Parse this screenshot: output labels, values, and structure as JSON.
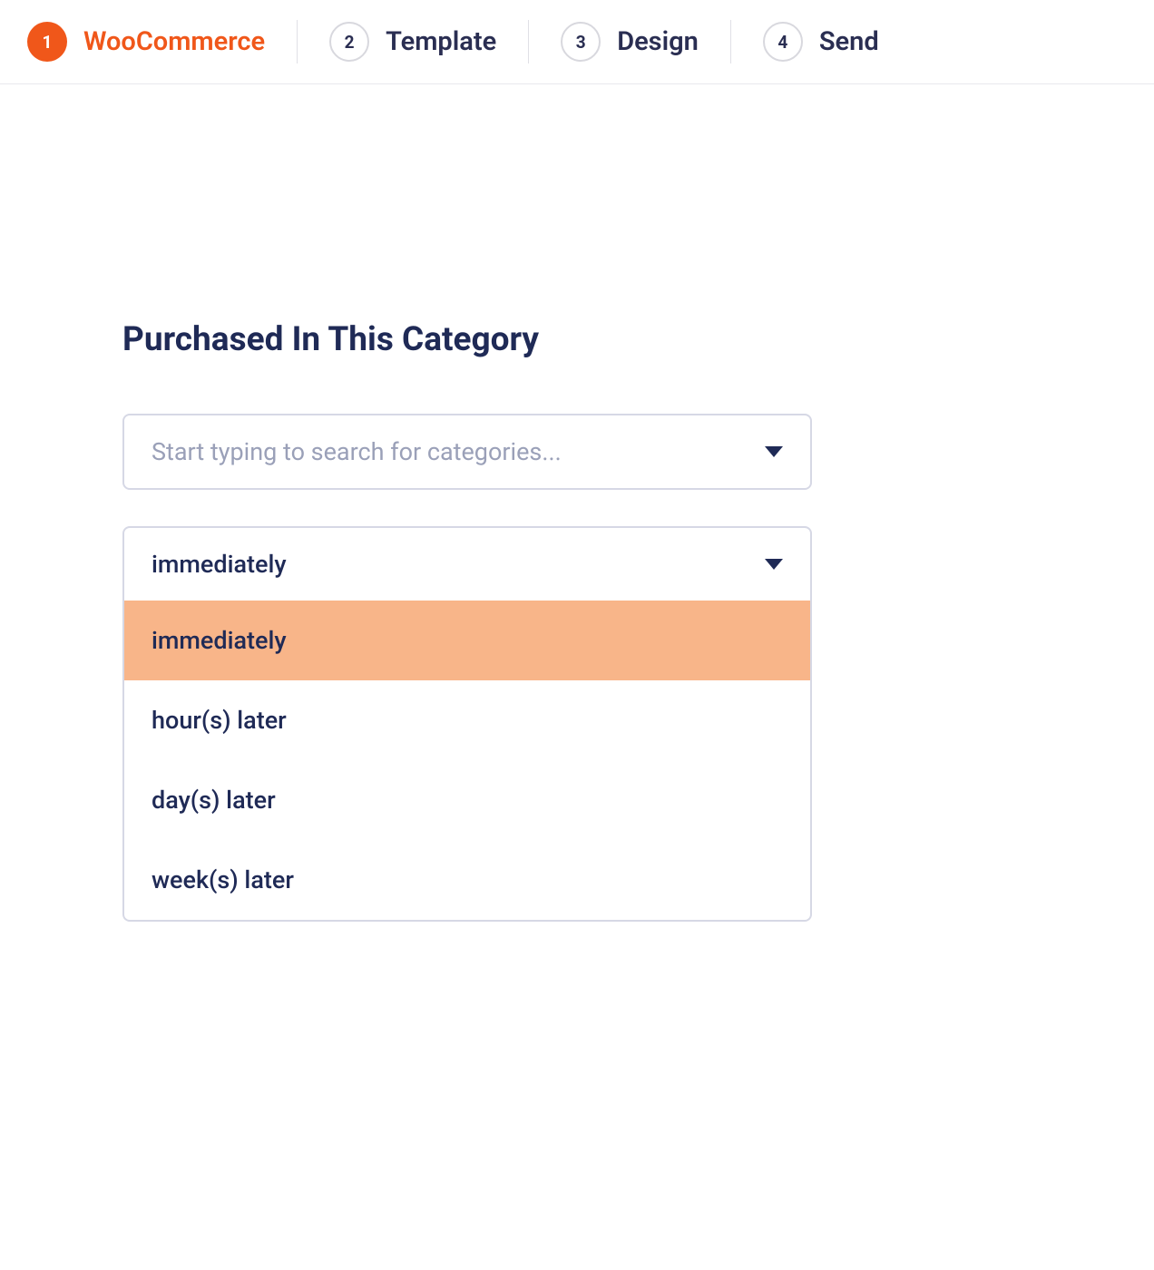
{
  "stepper": {
    "steps": [
      {
        "number": "1",
        "label": "WooCommerce",
        "active": true
      },
      {
        "number": "2",
        "label": "Template",
        "active": false
      },
      {
        "number": "3",
        "label": "Design",
        "active": false
      },
      {
        "number": "4",
        "label": "Send",
        "active": false
      }
    ]
  },
  "section": {
    "title": "Purchased In This Category"
  },
  "category_select": {
    "placeholder": "Start typing to search for categories..."
  },
  "timing_select": {
    "selected": "immediately",
    "options": [
      {
        "label": "immediately",
        "highlighted": true
      },
      {
        "label": "hour(s) later",
        "highlighted": false
      },
      {
        "label": "day(s) later",
        "highlighted": false
      },
      {
        "label": "week(s) later",
        "highlighted": false
      }
    ]
  }
}
